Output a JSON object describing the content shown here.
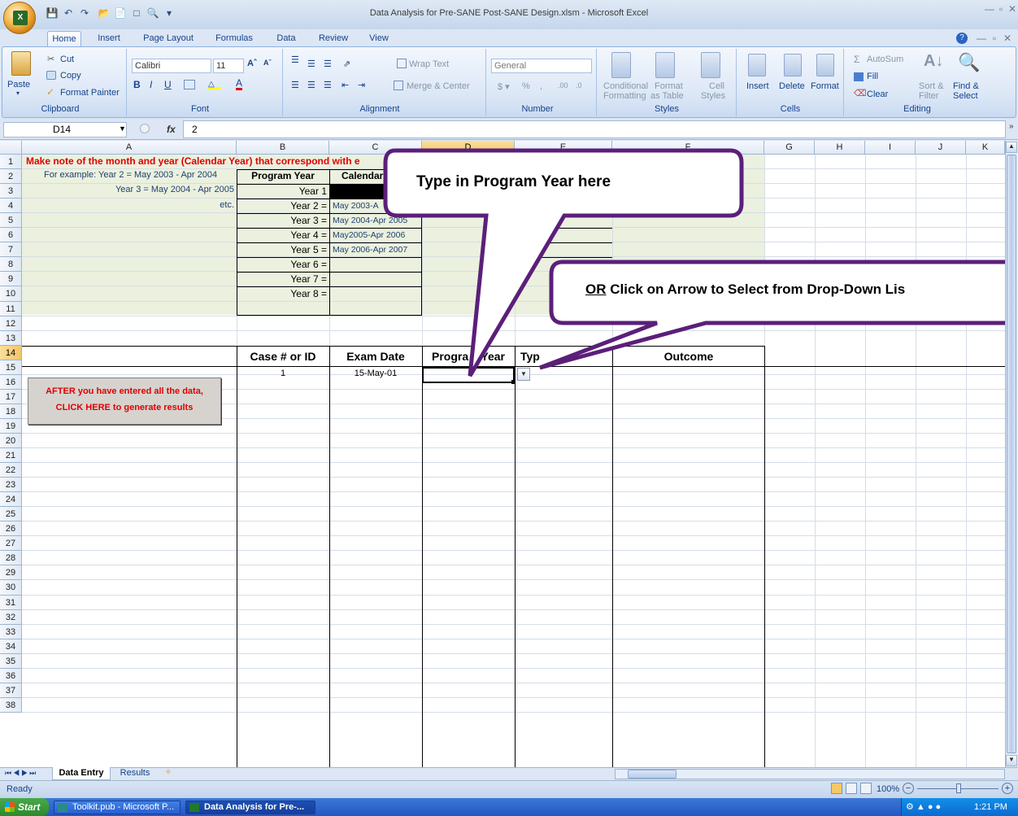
{
  "window": {
    "title": "Data Analysis for Pre-SANE Post-SANE Design.xlsm - Microsoft Excel"
  },
  "ribbon_tabs": [
    "Home",
    "Insert",
    "Page Layout",
    "Formulas",
    "Data",
    "Review",
    "View"
  ],
  "ribbon": {
    "clipboard": {
      "label": "Clipboard",
      "paste": "Paste",
      "cut": "Cut",
      "copy": "Copy",
      "format_painter": "Format Painter"
    },
    "font": {
      "label": "Font",
      "name": "Calibri",
      "size": "11"
    },
    "alignment": {
      "label": "Alignment",
      "wrap_text": "Wrap Text",
      "merge_center": "Merge & Center"
    },
    "number": {
      "label": "Number",
      "format": "General"
    },
    "styles": {
      "label": "Styles",
      "conditional": "Conditional Formatting",
      "conditional_l1": "Conditional",
      "conditional_l2": "Formatting",
      "format_table_l1": "Format",
      "format_table_l2": "as Table",
      "cell_styles_l1": "Cell",
      "cell_styles_l2": "Styles"
    },
    "cells": {
      "label": "Cells",
      "insert": "Insert",
      "delete": "Delete",
      "format": "Format"
    },
    "editing": {
      "label": "Editing",
      "autosum": "AutoSum",
      "fill": "Fill",
      "clear": "Clear",
      "sort_l1": "Sort &",
      "sort_l2": "Filter",
      "find_l1": "Find &",
      "find_l2": "Select"
    }
  },
  "formula_bar": {
    "name_box": "D14",
    "fx": "fx",
    "value": "2"
  },
  "columns": [
    "A",
    "B",
    "C",
    "D",
    "E",
    "F",
    "G",
    "H",
    "I",
    "J",
    "K"
  ],
  "rows": [
    "1",
    "2",
    "3",
    "4",
    "5",
    "6",
    "7",
    "8",
    "9",
    "10",
    "11",
    "12",
    "13",
    "14",
    "15",
    "16",
    "17",
    "18",
    "19",
    "20",
    "21",
    "22",
    "23",
    "24",
    "25",
    "26",
    "27",
    "28",
    "29",
    "30",
    "31",
    "32",
    "33",
    "34",
    "35",
    "36",
    "37",
    "38"
  ],
  "sheet": {
    "a1": "Make note of the month and year (Calendar Year) that correspond with e",
    "a2": "For example:  Year 2 = May 2003 - Apr 2004",
    "a3": "Year 3 = May 2004 - Apr 2005",
    "a4": "etc.",
    "program_year_header": "Program Year",
    "calendar_header": "Calendar",
    "years": [
      "Year 1",
      "Year 2 =",
      "Year 3 =",
      "Year 4 =",
      "Year 5 =",
      "Year 6 =",
      "Year 7 =",
      "Year 8 ="
    ],
    "calendar_values": [
      "",
      "May 2003-A",
      "May 2004-Apr 2005",
      "May2005-Apr 2006",
      "May 2006-Apr 2007",
      "",
      "",
      ""
    ],
    "e_equals": "=",
    "table_headers": {
      "case": "Case # or ID",
      "exam_date": "Exam Date",
      "program_year": "Progra    Year",
      "type": "Typ",
      "outcome": "Outcome"
    },
    "row14": {
      "case": "1",
      "exam_date": "15-May-01"
    },
    "results_button_l1": "AFTER you have entered all the data,",
    "results_button_l2": "CLICK HERE to generate results"
  },
  "callouts": {
    "one": "Type in Program Year here",
    "two_prefix": "OR",
    "two_rest": " Click on Arrow to Select from Drop-Down Lis"
  },
  "sheet_tabs": [
    "Data Entry",
    "Results"
  ],
  "status": {
    "ready": "Ready",
    "zoom": "100%"
  },
  "taskbar": {
    "start": "Start",
    "task1": "Toolkit.pub - Microsoft P...",
    "task2": "Data Analysis for Pre-...",
    "clock": "1:21 PM"
  },
  "colors": {
    "accent_red": "#e00000",
    "callout_border": "#5b1f7a",
    "green_fill": "#ebf1de"
  }
}
